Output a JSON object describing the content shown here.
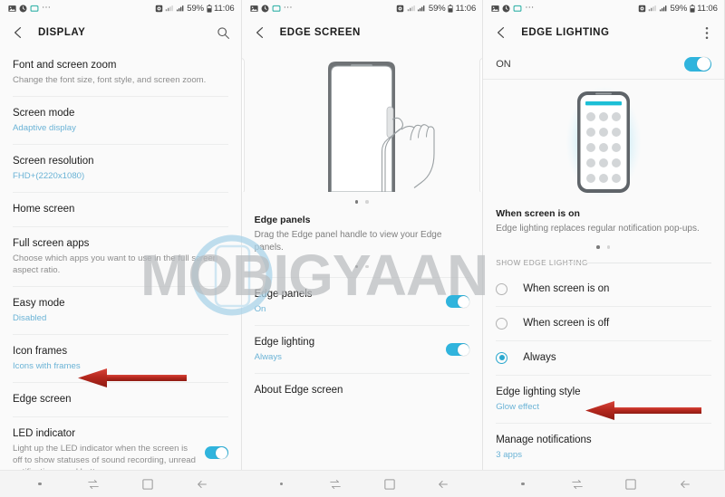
{
  "statusbar": {
    "battery": "59%",
    "time": "11:06",
    "icons": [
      "image-icon",
      "clock-icon",
      "message-icon",
      "overflow-dots-icon",
      "alarm-icon",
      "wifi-icon",
      "signal-icon"
    ]
  },
  "watermark": {
    "text": "MOBIGYAAN"
  },
  "panel1": {
    "title": "DISPLAY",
    "back_icon": "back-chevron-icon",
    "action_icon": "search-icon",
    "items": [
      {
        "title": "Font and screen zoom",
        "sub": "Change the font size, font style, and screen zoom.",
        "sub_style": "grey",
        "toggle": null
      },
      {
        "title": "Screen mode",
        "sub": "Adaptive display",
        "sub_style": "blue",
        "toggle": null
      },
      {
        "title": "Screen resolution",
        "sub": "FHD+(2220x1080)",
        "sub_style": "blue",
        "toggle": null
      },
      {
        "title": "Home screen",
        "sub": "",
        "sub_style": "none",
        "toggle": null
      },
      {
        "title": "Full screen apps",
        "sub": "Choose which apps you want to use in the full screen aspect ratio.",
        "sub_style": "grey",
        "toggle": null
      },
      {
        "title": "Easy mode",
        "sub": "Disabled",
        "sub_style": "blue",
        "toggle": null
      },
      {
        "title": "Icon frames",
        "sub": "Icons with frames",
        "sub_style": "blue",
        "toggle": null
      },
      {
        "title": "Edge screen",
        "sub": "",
        "sub_style": "none",
        "toggle": null
      },
      {
        "title": "LED indicator",
        "sub": "Light up the LED indicator when the screen is off to show statuses of sound recording, unread notifications, and battery.",
        "sub_style": "grey",
        "toggle": "on"
      }
    ]
  },
  "panel2": {
    "title": "EDGE SCREEN",
    "back_icon": "back-chevron-icon",
    "illustration": "phone-edge-panel-handle-swipe-illustration",
    "blurb_title": "Edge panels",
    "blurb_desc": "Drag the Edge panel handle to view your Edge panels.",
    "pager": {
      "count": 2,
      "active": 0
    },
    "items": [
      {
        "title": "Edge panels",
        "sub": "On",
        "sub_style": "blue",
        "toggle": "on"
      },
      {
        "title": "Edge lighting",
        "sub": "Always",
        "sub_style": "blue",
        "toggle": "on"
      },
      {
        "title": "About Edge screen",
        "sub": "",
        "sub_style": "none",
        "toggle": null
      }
    ]
  },
  "panel3": {
    "title": "EDGE LIGHTING",
    "back_icon": "back-chevron-icon",
    "action_icon": "overflow-menu-icon",
    "on_label": "ON",
    "on_toggle": "on",
    "illustration": "phone-edge-lighting-glow-illustration",
    "blurb_title": "When screen is on",
    "blurb_desc": "Edge lighting replaces regular notification pop-ups.",
    "pager": {
      "count": 2,
      "active": 0
    },
    "section_label": "SHOW EDGE LIGHTING",
    "radios": [
      {
        "label": "When screen is on",
        "selected": false
      },
      {
        "label": "When screen is off",
        "selected": false
      },
      {
        "label": "Always",
        "selected": true
      }
    ],
    "items": [
      {
        "title": "Edge lighting style",
        "sub": "Glow effect",
        "sub_style": "blue"
      },
      {
        "title": "Manage notifications",
        "sub": "3 apps",
        "sub_style": "blue"
      }
    ]
  },
  "navbar": {
    "buttons": [
      "recents-dot-icon",
      "recents-icon",
      "home-icon",
      "back-icon"
    ]
  },
  "annotations": {
    "arrow1_target": "Edge screen",
    "arrow2_target": "Edge lighting style"
  },
  "colors": {
    "accent": "#30b4dd",
    "sub_blue": "#6bb3d6",
    "arrow_red": "#b5281e",
    "bg": "#fafafa"
  }
}
